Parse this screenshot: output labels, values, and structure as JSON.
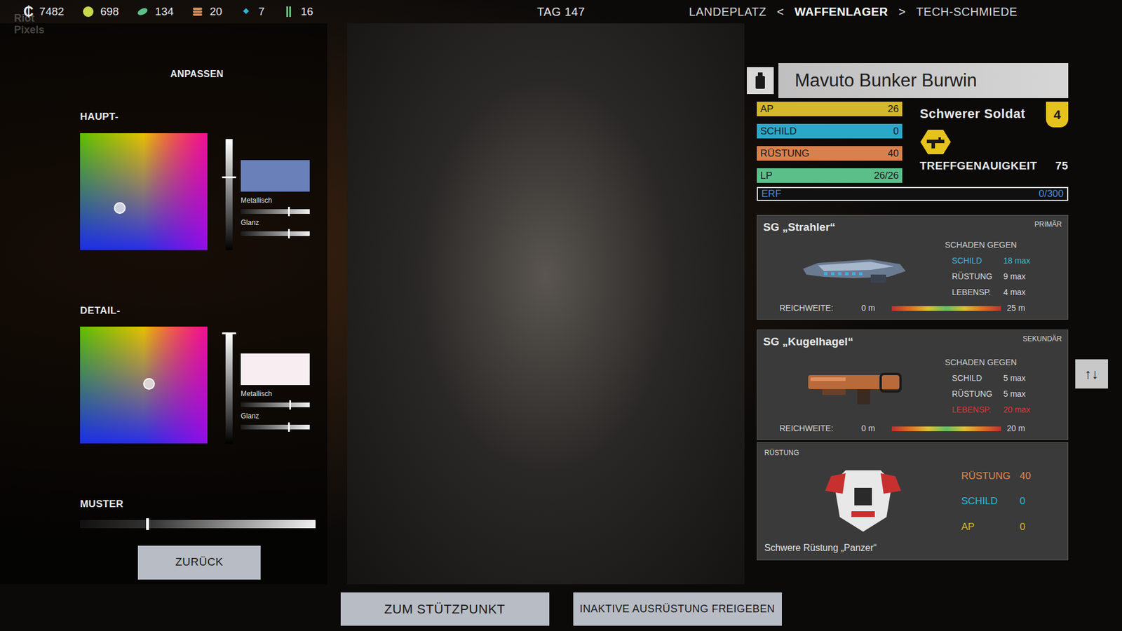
{
  "watermark": "Riot Pixels",
  "resources": [
    {
      "kind": "credits",
      "symbol": "₵",
      "value": "7482",
      "color": "#e8e8e8"
    },
    {
      "kind": "ore",
      "value": "698",
      "color": "#c8d84a"
    },
    {
      "kind": "leaf",
      "value": "134",
      "color": "#5cc08a"
    },
    {
      "kind": "stack",
      "value": "20",
      "color": "#e08a50"
    },
    {
      "kind": "gem",
      "value": "7",
      "color": "#2ab8d8"
    },
    {
      "kind": "bars",
      "value": "16",
      "color": "#6cc080"
    }
  ],
  "day": "TAG 147",
  "nav": {
    "prev": "LANDEPLATZ",
    "prev_arrow": "<",
    "current": "WAFFENLAGER",
    "next_arrow": ">",
    "next": "TECH-SCHMIEDE"
  },
  "customize": {
    "title": "ANPASSEN",
    "sections": [
      {
        "label": "HAUPT-",
        "picker": {
          "x": 0.31,
          "y": 0.64
        },
        "brightness": 0.66,
        "swatch": "#6a80b8",
        "sliders": [
          {
            "label": "Metallisch",
            "level": 0.69
          },
          {
            "label": "Glanz",
            "level": 0.69
          }
        ]
      },
      {
        "label": "DETAIL-",
        "picker": {
          "x": 0.54,
          "y": 0.49
        },
        "brightness": 1.0,
        "swatch": "#f8eef2",
        "sliders": [
          {
            "label": "Metallisch",
            "level": 0.7
          },
          {
            "label": "Glanz",
            "level": 0.69
          }
        ]
      }
    ],
    "pattern": {
      "label": "MUSTER",
      "level": 0.28
    },
    "back_button": "ZURÜCK"
  },
  "soldier": {
    "name": "Mavuto Bunker Burwin",
    "class": "Schwerer Soldat",
    "rank": "4",
    "stats": [
      {
        "label": "AP",
        "value": "26",
        "level": 1,
        "color": "#d4b72a"
      },
      {
        "label": "SCHILD",
        "value": "0",
        "level": 1,
        "color": "#2aa8c8"
      },
      {
        "label": "RÜSTUNG",
        "value": "40",
        "level": 1,
        "color": "#d8814e"
      },
      {
        "label": "LP",
        "value": "26/26",
        "level": 1,
        "color": "#5bbf8a"
      }
    ],
    "accuracy": {
      "label": "TREFFGENAUIGKEIT",
      "value": "75"
    },
    "xp": {
      "label": "ERF",
      "value": "0/300",
      "level": 0
    }
  },
  "weapons": [
    {
      "name": "SG „Strahler“",
      "slot": "PRIMÄR",
      "kind": "beam",
      "damage_title": "SCHADEN GEGEN",
      "damage": [
        {
          "label": "SCHILD",
          "value": "18 max",
          "color": "#3ab8d8"
        },
        {
          "label": "RÜSTUNG",
          "value": "9 max",
          "color": "#d8d8d8"
        },
        {
          "label": "LEBENSP.",
          "value": "4 max",
          "color": "#d8d8d8"
        }
      ],
      "range": {
        "label": "REICHWEITE:",
        "min": "0 m",
        "max": "25 m"
      }
    },
    {
      "name": "SG „Kugelhagel“",
      "slot": "SEKUNDÄR",
      "kind": "bullet",
      "damage_title": "SCHADEN GEGEN",
      "damage": [
        {
          "label": "SCHILD",
          "value": "5 max",
          "color": "#d8d8d8"
        },
        {
          "label": "RÜSTUNG",
          "value": "5 max",
          "color": "#d8d8d8"
        },
        {
          "label": "LEBENSP.",
          "value": "20 max",
          "color": "#d83838"
        }
      ],
      "range": {
        "label": "REICHWEITE:",
        "min": "0 m",
        "max": "20 m"
      }
    }
  ],
  "swap_button": "↑↓",
  "armor": {
    "section": "RÜSTUNG",
    "name": "Schwere Rüstung „Panzer“",
    "stats": [
      {
        "label": "RÜSTUNG",
        "value": "40",
        "color": "#e0884a"
      },
      {
        "label": "SCHILD",
        "value": "0",
        "color": "#2ab8d8"
      },
      {
        "label": "AP",
        "value": "0",
        "color": "#d4b72a"
      }
    ]
  },
  "buttons": [
    "ZUM STÜTZPUNKT",
    "INAKTIVE AUSRÜSTUNG FREIGEBEN"
  ]
}
